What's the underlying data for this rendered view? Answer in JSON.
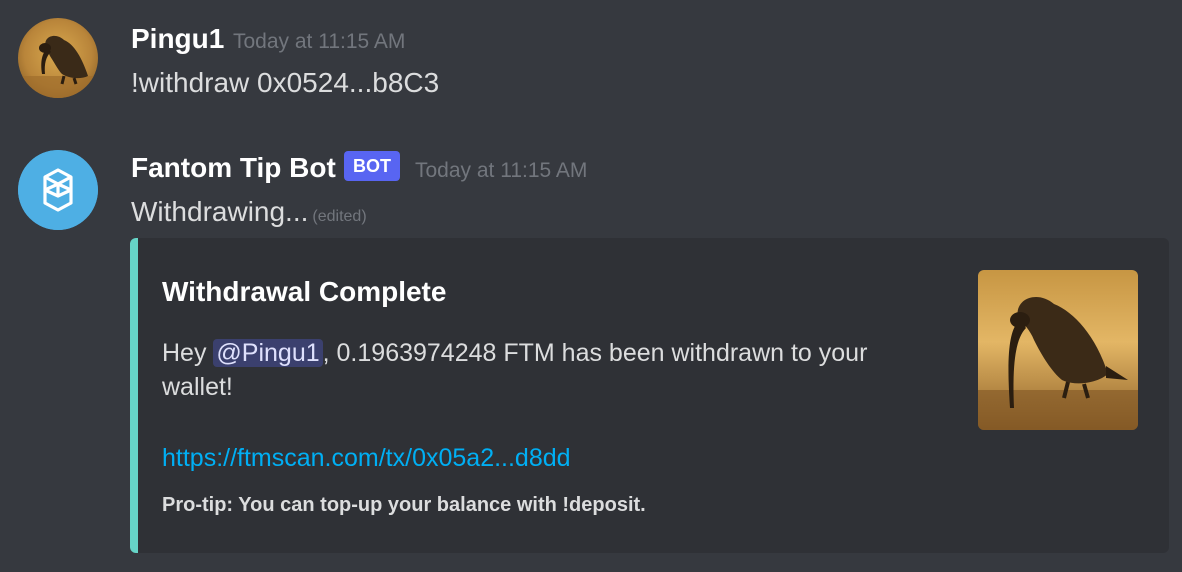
{
  "messages": [
    {
      "username": "Pingu1",
      "timestamp": "Today at 11:15 AM",
      "content": "!withdraw 0x0524...b8C3",
      "avatar_icon": "penguin-avatar"
    },
    {
      "username": "Fantom Tip Bot",
      "bot_tag": "BOT",
      "timestamp": "Today at 11:15 AM",
      "content": "Withdrawing...",
      "edited_label": "(edited)",
      "avatar_icon": "fantom-logo",
      "avatar_color": "#4eafe4",
      "embed": {
        "accent_color": "#66d4c7",
        "title": "Withdrawal Complete",
        "description_prefix": "Hey ",
        "mention": "@Pingu1",
        "description_suffix": ", 0.1963974248 FTM has been withdrawn to your wallet!",
        "link": "https://ftmscan.com/tx/0x05a2...d8dd",
        "footer": "Pro-tip: You can top-up your balance with !deposit.",
        "thumbnail_icon": "penguin-image"
      }
    }
  ],
  "colors": {
    "background": "#36393f",
    "embed_background": "#2f3136",
    "bot_tag": "#5865f2",
    "link": "#00aff4"
  }
}
